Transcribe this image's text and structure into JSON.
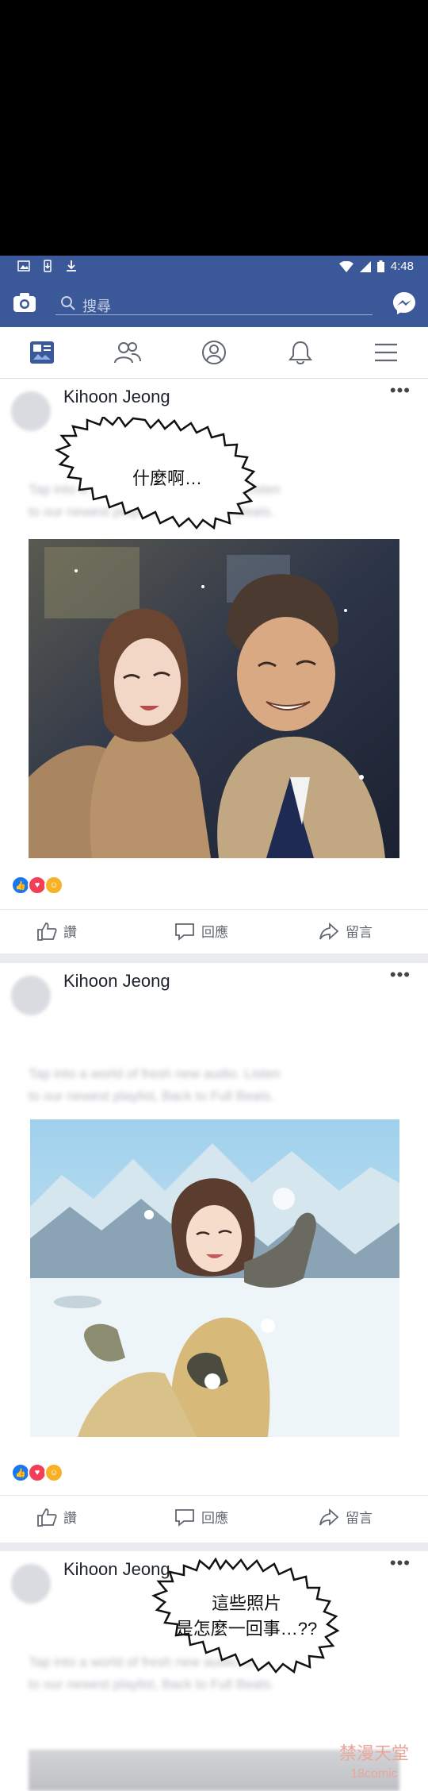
{
  "status": {
    "time": "4:48"
  },
  "search": {
    "placeholder": "搜尋"
  },
  "posts": [
    {
      "author": "Kihoon Jeong",
      "body_line1": "Tap into a world of fresh new audio. Listen",
      "body_line2": "to our newest playlist, Back to Full Beats.",
      "speech": "什麼啊…",
      "actions": {
        "like": "讚",
        "comment": "回應",
        "share": "留言"
      }
    },
    {
      "author": "Kihoon Jeong",
      "body_line1": "Tap into a world of fresh new audio. Listen",
      "body_line2": "to our newest playlist, Back to Full Beats.",
      "actions": {
        "like": "讚",
        "comment": "回應",
        "share": "留言"
      }
    },
    {
      "author": "Kihoon Jeong",
      "body_line1": "Tap into a world of fresh new audio. Listen",
      "body_line2": "to our newest playlist, Back to Full Beats.",
      "speech_line1": "這些照片",
      "speech_line2": "是怎麼一回事…??"
    }
  ],
  "more": "•••",
  "watermark": {
    "line1": "禁漫天堂",
    "line2": "18comic"
  },
  "colors": {
    "fb_blue": "#3b5998",
    "like_blue": "#1877f2",
    "love_red": "#f33e58",
    "haha_yellow": "#f7b125"
  }
}
